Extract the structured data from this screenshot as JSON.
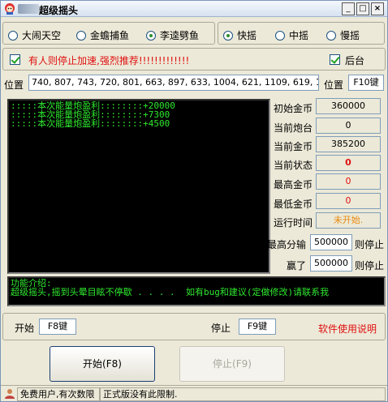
{
  "window": {
    "title": "超级摇头",
    "minimize": "_",
    "maximize": "□",
    "close": "×"
  },
  "modes": [
    {
      "label": "大闹天空",
      "selected": false
    },
    {
      "label": "金蟾捕鱼",
      "selected": false
    },
    {
      "label": "李逵劈鱼",
      "selected": true
    }
  ],
  "speeds": [
    {
      "label": "快摇",
      "selected": true
    },
    {
      "label": "中摇",
      "selected": false
    },
    {
      "label": "慢摇",
      "selected": false
    }
  ],
  "stop_option": {
    "label": "有人则停止加速,强烈推荐!!!!!!!!!!!!!",
    "checked": true
  },
  "background_option": {
    "label": "后台",
    "checked": true
  },
  "position": {
    "label": "位置",
    "value": "740, 807, 743, 720, 801, 663, 897, 633, 1004, 621, 1109, 619, 1206, 639,",
    "key_label": "位置",
    "key_value": "F10键"
  },
  "log_lines": [
    ":::::本次能量炮盈利::::::::+20000",
    ":::::本次能量炮盈利::::::::+7300",
    ":::::本次能量炮盈利::::::::+4500"
  ],
  "stats": {
    "initial_gold_label": "初始金币",
    "initial_gold": "360000",
    "current_cannon_label": "当前炮台",
    "current_cannon": "0",
    "current_gold_label": "当前金币",
    "current_gold": "385200",
    "current_state_label": "当前状态",
    "current_state": "0",
    "max_gold_label": "最高金币",
    "max_gold": "0",
    "min_gold_label": "最低金币",
    "min_gold": "0",
    "runtime_label": "运行时间",
    "runtime": "未开始."
  },
  "limits": {
    "max_loss_label": "最高分输",
    "max_loss": "500000",
    "max_loss_suffix": "则停止",
    "win_label": "赢了",
    "win": "500000",
    "win_suffix": "则停止"
  },
  "info": {
    "line1": "功能介绍:",
    "line2": "超级摇头,摇到头晕目眩不停歇 . . . .",
    "line3": "如有bug和建议(定做修改)请联系我"
  },
  "hotkeys": {
    "start_label": "开始",
    "start_key": "F8键",
    "stop_label": "停止",
    "stop_key": "F9键",
    "manual_link": "软件使用说明"
  },
  "buttons": {
    "start": "开始(F8)",
    "stop": "停止(F9)"
  },
  "statusbar": {
    "user_text": "免费用户,有次数限",
    "notice": "正式版没有此限制."
  },
  "colors": {
    "accent_red": "#e01010",
    "console_green": "#2ee82e",
    "runtime_orange": "#e88a10",
    "info_bg": "#000000"
  }
}
